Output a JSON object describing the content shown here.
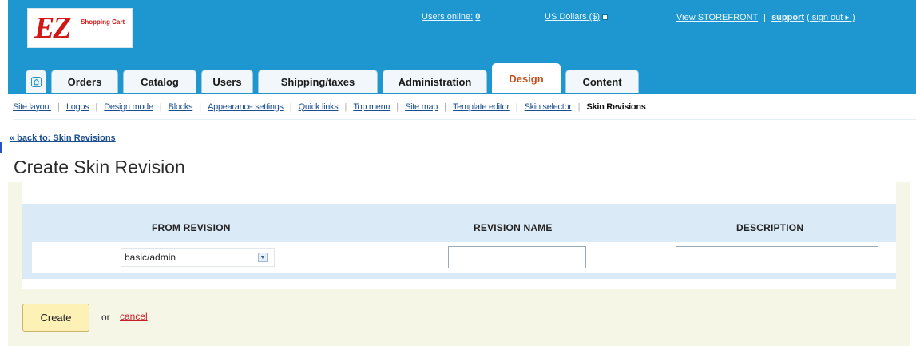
{
  "header": {
    "logo_text": "EZ",
    "logo_subtitle": "Shopping Cart",
    "users_online_label": "Users online:",
    "users_online_count": "0",
    "currency": "US Dollars ($)",
    "storefront": "View STOREFRONT",
    "separator": "|",
    "support": "support",
    "sign_out": "( sign out ▸ )"
  },
  "tabs": [
    {
      "label": "",
      "icon": "home-icon"
    },
    {
      "label": "Orders"
    },
    {
      "label": "Catalog"
    },
    {
      "label": "Users"
    },
    {
      "label": "Shipping/taxes"
    },
    {
      "label": "Administration"
    },
    {
      "label": "Design",
      "active": true
    },
    {
      "label": "Content"
    }
  ],
  "subnav": [
    "Site layout",
    "Logos",
    "Design mode",
    "Blocks",
    "Appearance settings",
    "Quick links",
    "Top menu",
    "Site map",
    "Template editor",
    "Skin selector",
    "Skin Revisions"
  ],
  "back_link": "« back to: Skin Revisions",
  "page_title": "Create Skin Revision",
  "form": {
    "col_from": "FROM REVISION",
    "col_name": "REVISION NAME",
    "col_desc": "DESCRIPTION",
    "from_value": "basic/admin",
    "name_value": "",
    "desc_value": ""
  },
  "actions": {
    "create": "Create",
    "or": "or",
    "cancel": "cancel"
  },
  "colors": {
    "header_bg": "#1e96cf",
    "active_tab_text": "#c8501e",
    "create_button_bg": "#fdf1b6",
    "cancel_link": "#c81e2a"
  }
}
